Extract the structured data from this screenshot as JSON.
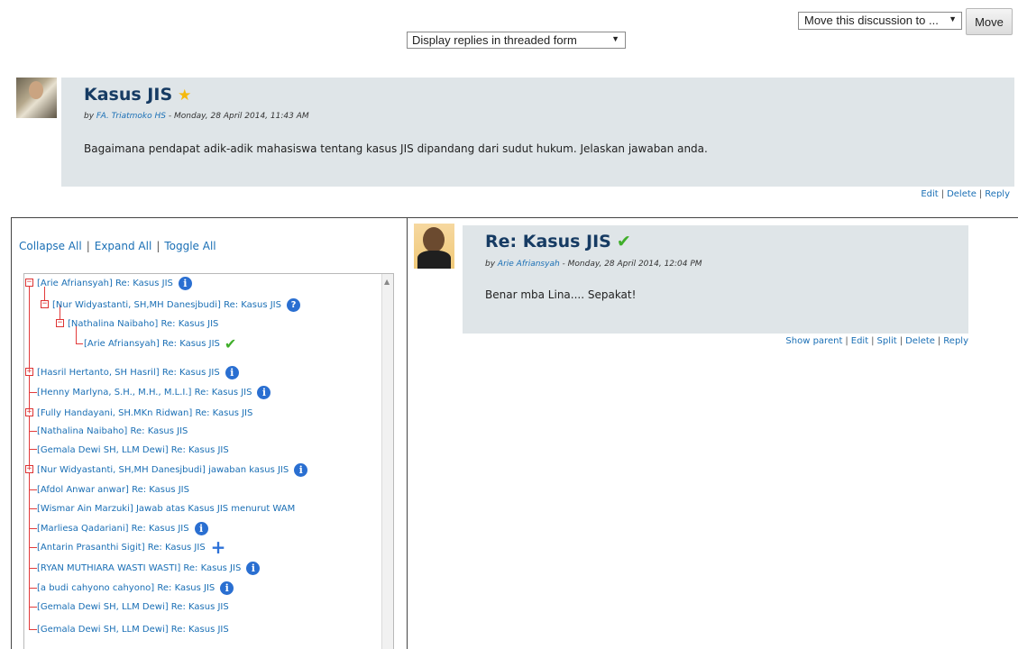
{
  "top": {
    "move_select": "Move this discussion to ...",
    "move_button": "Move",
    "display_select": "Display replies in threaded form"
  },
  "main_post": {
    "title": "Kasus JIS",
    "by_prefix": "by",
    "author": "FA. Triatmoko HS",
    "date": " - Monday, 28 April 2014, 11:43 AM",
    "body": "Bagaimana pendapat adik-adik mahasiswa tentang kasus JIS dipandang dari sudut hukum. Jelaskan jawaban anda.",
    "actions": [
      "Edit",
      "Delete",
      "Reply"
    ],
    "star_color": "#f5b90c"
  },
  "tree_controls": [
    "Collapse All",
    "Expand All",
    "Toggle All"
  ],
  "tree": [
    {
      "text": "[Arie Afriansyah] Re: Kasus JIS",
      "icon": "info"
    },
    {
      "text": "[Nur Widyastanti, SH,MH Danesjbudi] Re: Kasus JIS",
      "icon": "help"
    },
    {
      "text": "[Nathalina Naibaho] Re: Kasus JIS",
      "icon": ""
    },
    {
      "text": "[Arie Afriansyah] Re: Kasus JIS",
      "icon": "check"
    },
    {
      "text": "[Hasril Hertanto, SH Hasril] Re: Kasus JIS",
      "icon": "info"
    },
    {
      "text": "[Henny Marlyna, S.H., M.H., M.L.I.] Re: Kasus JIS",
      "icon": "info"
    },
    {
      "text": "[Fully Handayani, SH.MKn Ridwan] Re: Kasus JIS",
      "icon": ""
    },
    {
      "text": "[Nathalina Naibaho] Re: Kasus JIS",
      "icon": ""
    },
    {
      "text": "[Gemala Dewi SH, LLM Dewi] Re: Kasus JIS",
      "icon": ""
    },
    {
      "text": "[Nur Widyastanti, SH,MH Danesjbudi] jawaban kasus JIS",
      "icon": "info"
    },
    {
      "text": "[Afdol Anwar anwar] Re: Kasus JIS",
      "icon": ""
    },
    {
      "text": "[Wismar Ain Marzuki] Jawab atas Kasus JIS menurut WAM",
      "icon": ""
    },
    {
      "text": "[Marliesa Qadariani] Re: Kasus JIS",
      "icon": "info"
    },
    {
      "text": "[Antarin Prasanthi Sigit] Re: Kasus JIS",
      "icon": "plus"
    },
    {
      "text": "[RYAN MUTHIARA WASTI WASTI] Re: Kasus JIS",
      "icon": "info"
    },
    {
      "text": "[a budi cahyono cahyono] Re: Kasus JIS",
      "icon": "info"
    },
    {
      "text": "[Gemala Dewi SH, LLM Dewi] Re: Kasus JIS",
      "icon": ""
    },
    {
      "text": "[Gemala Dewi SH, LLM Dewi] Re: Kasus JIS",
      "icon": ""
    }
  ],
  "reply_post": {
    "title": "Re: Kasus JIS",
    "by_prefix": "by",
    "author": "Arie Afriansyah",
    "date": " - Monday, 28 April 2014, 12:04 PM",
    "body": "Benar mba Lina.... Sepakat!",
    "actions": [
      "Show parent",
      "Edit",
      "Split",
      "Delete",
      "Reply"
    ]
  },
  "colors": {
    "link": "#1a6fb5",
    "post_bg": "#dfe5e8",
    "title": "#163b63",
    "tree_line": "#e23b3b",
    "check": "#3fae2a"
  }
}
